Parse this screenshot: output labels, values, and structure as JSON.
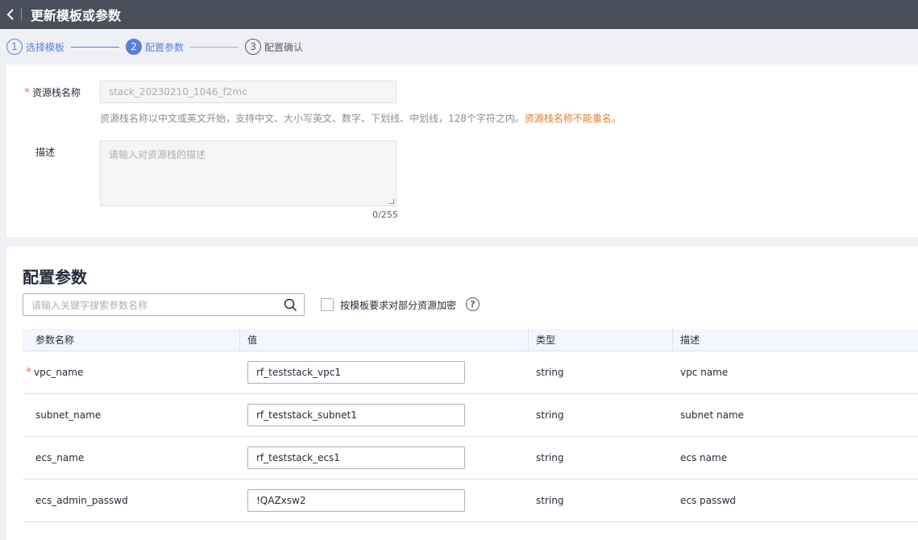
{
  "header": {
    "title": "更新模板或参数"
  },
  "steps": [
    {
      "num": "1",
      "label": "选择模板"
    },
    {
      "num": "2",
      "label": "配置参数"
    },
    {
      "num": "3",
      "label": "配置确认"
    }
  ],
  "form": {
    "required_mark": "*",
    "stack_name_label": "资源栈名称",
    "stack_name_value": "stack_20230210_1046_f2mc",
    "stack_name_help": "资源栈名称以中文或英文开始，支持中文、大小写英文、数字、下划线、中划线，128个字符之内。",
    "stack_name_warning": "资源栈名称不能重名。",
    "desc_label": "描述",
    "desc_placeholder": "请输入对资源栈的描述",
    "desc_counter": "0/255"
  },
  "params": {
    "title": "配置参数",
    "search_placeholder": "请输入关键字搜索参数名称",
    "encrypt_label": "按模板要求对部分资源加密",
    "encrypt_checked": false,
    "help_glyph": "?",
    "columns": [
      "参数名称",
      "值",
      "类型",
      "描述"
    ],
    "rows": [
      {
        "required": "*",
        "name": "vpc_name",
        "value": "rf_teststack_vpc1",
        "type": "string",
        "desc": "vpc name"
      },
      {
        "required": "",
        "name": "subnet_name",
        "value": "rf_teststack_subnet1",
        "type": "string",
        "desc": "subnet name"
      },
      {
        "required": "",
        "name": "ecs_name",
        "value": "rf_teststack_ecs1",
        "type": "string",
        "desc": "ecs name"
      },
      {
        "required": "",
        "name": "ecs_admin_passwd",
        "value": "!QAZxsw2",
        "type": "string",
        "desc": "ecs passwd"
      }
    ]
  }
}
